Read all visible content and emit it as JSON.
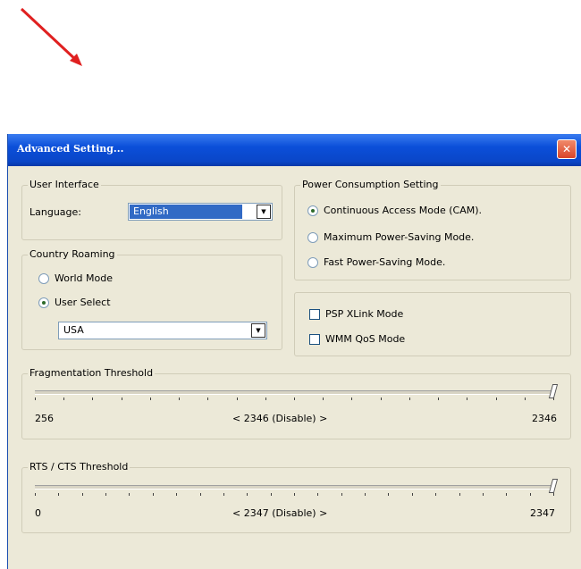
{
  "dialog": {
    "title": "Advanced Setting...",
    "close_glyph": "✕"
  },
  "user_interface": {
    "legend": "User Interface",
    "language_label": "Language:",
    "language_value": "English"
  },
  "country_roaming": {
    "legend": "Country Roaming",
    "world_mode": "World Mode",
    "user_select": "User Select",
    "selected": "User Select",
    "country_value": "USA"
  },
  "power": {
    "legend": "Power Consumption Setting",
    "cam": "Continuous Access Mode (CAM).",
    "max_psm": "Maximum Power-Saving Mode.",
    "fast_psm": "Fast Power-Saving Mode.",
    "selected": "Continuous Access Mode (CAM)."
  },
  "options": {
    "psp_xlink": "PSP XLink Mode",
    "wmm_qos": "WMM QoS Mode",
    "psp_xlink_checked": false,
    "wmm_qos_checked": false
  },
  "fragmentation": {
    "legend": "Fragmentation Threshold",
    "min": "256",
    "center": "< 2346 (Disable) >",
    "max": "2346",
    "value": 2346
  },
  "rts_cts": {
    "legend": "RTS / CTS Threshold",
    "min": "0",
    "center": "< 2347 (Disable) >",
    "max": "2347",
    "value": 2347
  },
  "colors": {
    "titlebar": "#0a46c8",
    "face": "#ece9d8",
    "selection": "#316ac5",
    "arrow": "#e02020"
  },
  "icons": {
    "arrow": "red-arrow-icon",
    "close": "close-icon",
    "dropdown": "chevron-down-icon"
  }
}
